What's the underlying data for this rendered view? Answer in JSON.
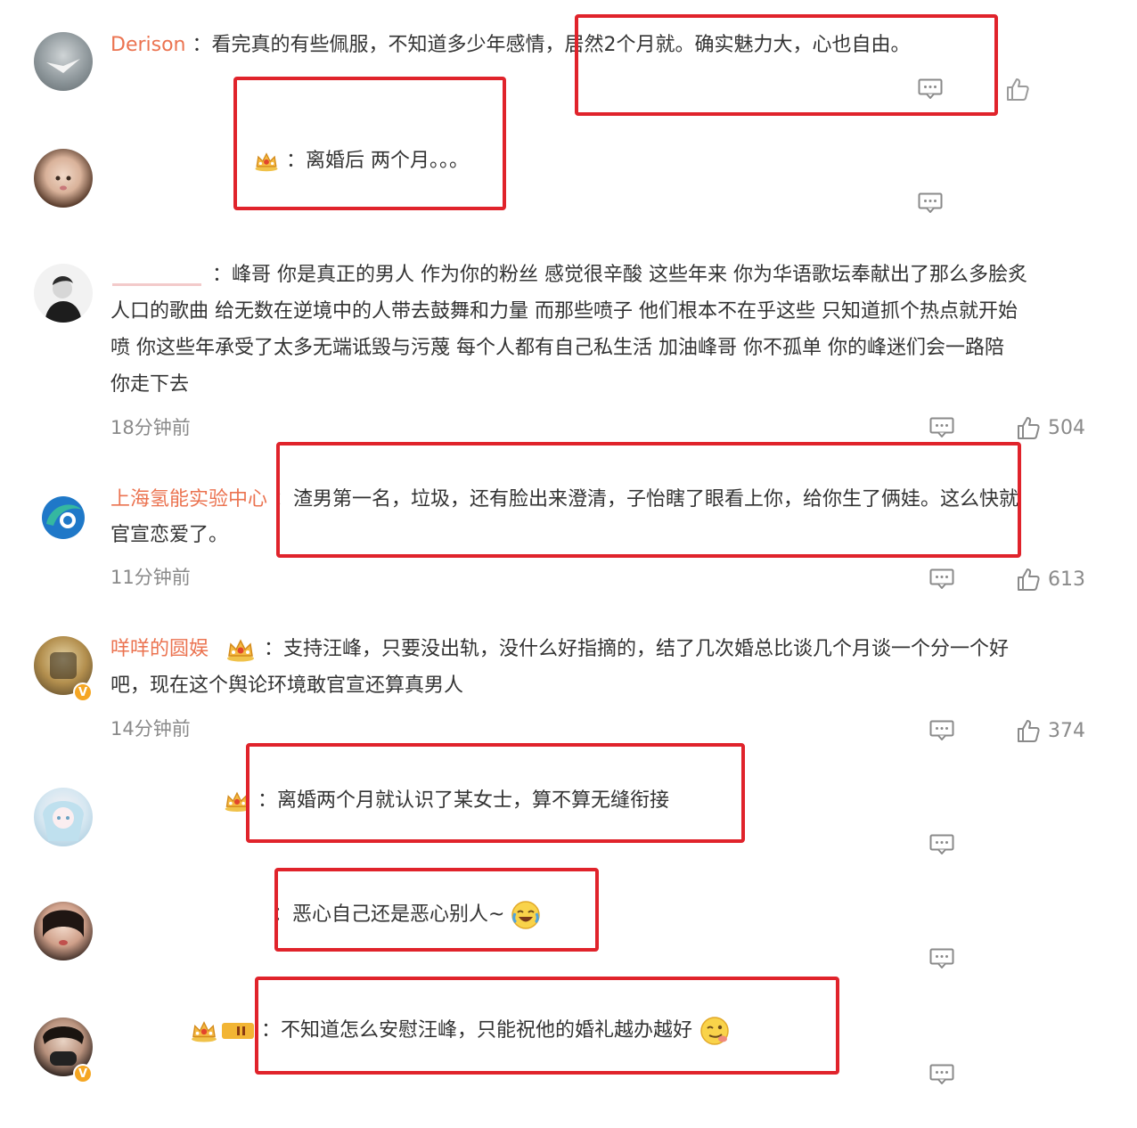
{
  "comments": [
    {
      "username": "Derison",
      "text": "：看完真的有些佩服，不知道多少年感情，居然2个月就。确实魅力大，心也自由。"
    },
    {
      "username": "",
      "text": "：离婚后 两个月。。。"
    },
    {
      "username": "",
      "lines": [
        "：峰哥 你是真正的男人 作为你的粉丝 感觉很辛酸 这些年来 你为华语歌坛奉献出了那么多脍炙",
        "人口的歌曲 给无数在逆境中的人带去鼓舞和力量 而那些喷子 他们根本不在乎这些 只知道抓个热点就开始",
        "喷 你这些年承受了太多无端诋毁与污蔑 每个人都有自己私生活 加油峰哥 你不孤单 你的峰迷们会一路陪",
        "你走下去"
      ],
      "time": "18分钟前",
      "likes": "504"
    },
    {
      "username": "上海氢能实验中心",
      "lines": [
        "：渣男第一名，垃圾，还有脸出来澄清，子怡瞎了眼看上你，给你生了俩娃。这么快就",
        "官宣恋爱了。"
      ],
      "time": "11分钟前",
      "likes": "613"
    },
    {
      "username": "咩咩的圆娱",
      "lines": [
        "：支持汪峰，只要没出轨，没什么好指摘的，结了几次婚总比谈几个月谈一个分一个好",
        "吧，现在这个舆论环境敢官宣还算真男人"
      ],
      "time": "14分钟前",
      "likes": "374"
    },
    {
      "username": "",
      "text": "：离婚两个月就认识了某女士，算不算无缝衔接"
    },
    {
      "username": "",
      "text": "：恶心自己还是恶心别人~"
    },
    {
      "username": "",
      "text": "：不知道怎么安慰汪峰，只能祝他的婚礼越办越好"
    }
  ],
  "icons": {
    "reply": "comment-bubble-icon",
    "like": "thumbs-up-icon",
    "crown": "crown-badge-icon",
    "verified": "verified-badge-icon"
  },
  "colors": {
    "username": "#eb7350",
    "highlight": "#e0232b",
    "meta": "#8a8a8a"
  }
}
